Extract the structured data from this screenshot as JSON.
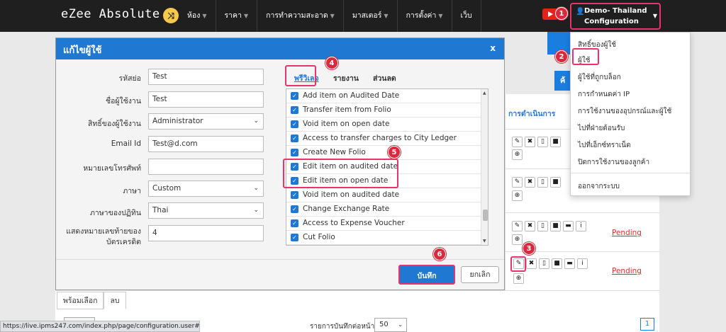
{
  "header": {
    "brand": "eZee Absolute",
    "nav": [
      "ห้อง",
      "ราคา",
      "การทำความสะอาด",
      "มาสเตอร์",
      "การตั้งค่า",
      "เว็บ"
    ],
    "user_line1": "Demo- Thailand",
    "user_line2": "Configuration"
  },
  "dropdown": {
    "items": [
      "สิทธิ์ของผู้ใช้",
      "ผู้ใช้",
      "ผู้ใช้ที่ถูกบล็อก",
      "การกำหนดค่า IP",
      "การใช้งานของอุปกรณ์และผู้ใช้",
      "ไปที่ฝ่ายต้อนรับ",
      "ไปที่เอ็กซ์ทราเน็ต",
      "ปิดการใช้งานของลูกค้า"
    ],
    "logout": "ออกจากระบบ"
  },
  "background": {
    "actions_header": "การดำเนินการ",
    "pending": "Pending",
    "tabs": [
      "พร้อมเลือก",
      "ลบ"
    ],
    "per_page_label": "รายการบันทึกต่อหน้า",
    "per_page_value": "50",
    "page": "1",
    "status_url": "https://live.ipms247.com/index.php/page/configuration.user#contact",
    "partial_button": "ค้"
  },
  "modal": {
    "title": "แก้ไขผู้ใช้",
    "close": "x",
    "fields": [
      {
        "label": "รหัสย่อ",
        "value": "Test",
        "type": "text"
      },
      {
        "label": "ชื่อผู้ใช้งาน",
        "value": "Test",
        "type": "text"
      },
      {
        "label": "สิทธิ์ของผู้ใช้งาน",
        "value": "Administrator",
        "type": "select"
      },
      {
        "label": "Email Id",
        "value": "Test@d.com",
        "type": "text"
      },
      {
        "label": "หมายเลขโทรศัพท์",
        "value": "",
        "type": "text"
      },
      {
        "label": "ภาษา",
        "value": "Custom",
        "type": "select"
      },
      {
        "label": "ภาษาของปฏิทิน",
        "value": "Thai",
        "type": "select"
      },
      {
        "label": "แสดงหมายเลขท้ายของ",
        "label2": "บัตรเครดิต",
        "value": "4",
        "type": "text"
      }
    ],
    "tabs": [
      "พรีวิเลจ",
      "รายงาน",
      "ส่วนลด"
    ],
    "permissions": [
      "Add item on Audited Date",
      "Transfer item from Folio",
      "Void item on open date",
      "Access to transfer charges to City Ledger",
      "Create New Folio",
      "Edit item on audited date",
      "Edit item on open date",
      "Void item on audited date",
      "Change Exchange Rate",
      "Access to Expense Voucher",
      "Cut Folio"
    ],
    "save": "บันทึก",
    "cancel": "ยกเลิก"
  },
  "badges": [
    "1",
    "2",
    "3",
    "4",
    "5",
    "6"
  ],
  "colors": {
    "primary": "#1f78d1",
    "highlight": "#e8336d",
    "badge": "#d8293d",
    "nav_bg": "#1f1f1f"
  }
}
